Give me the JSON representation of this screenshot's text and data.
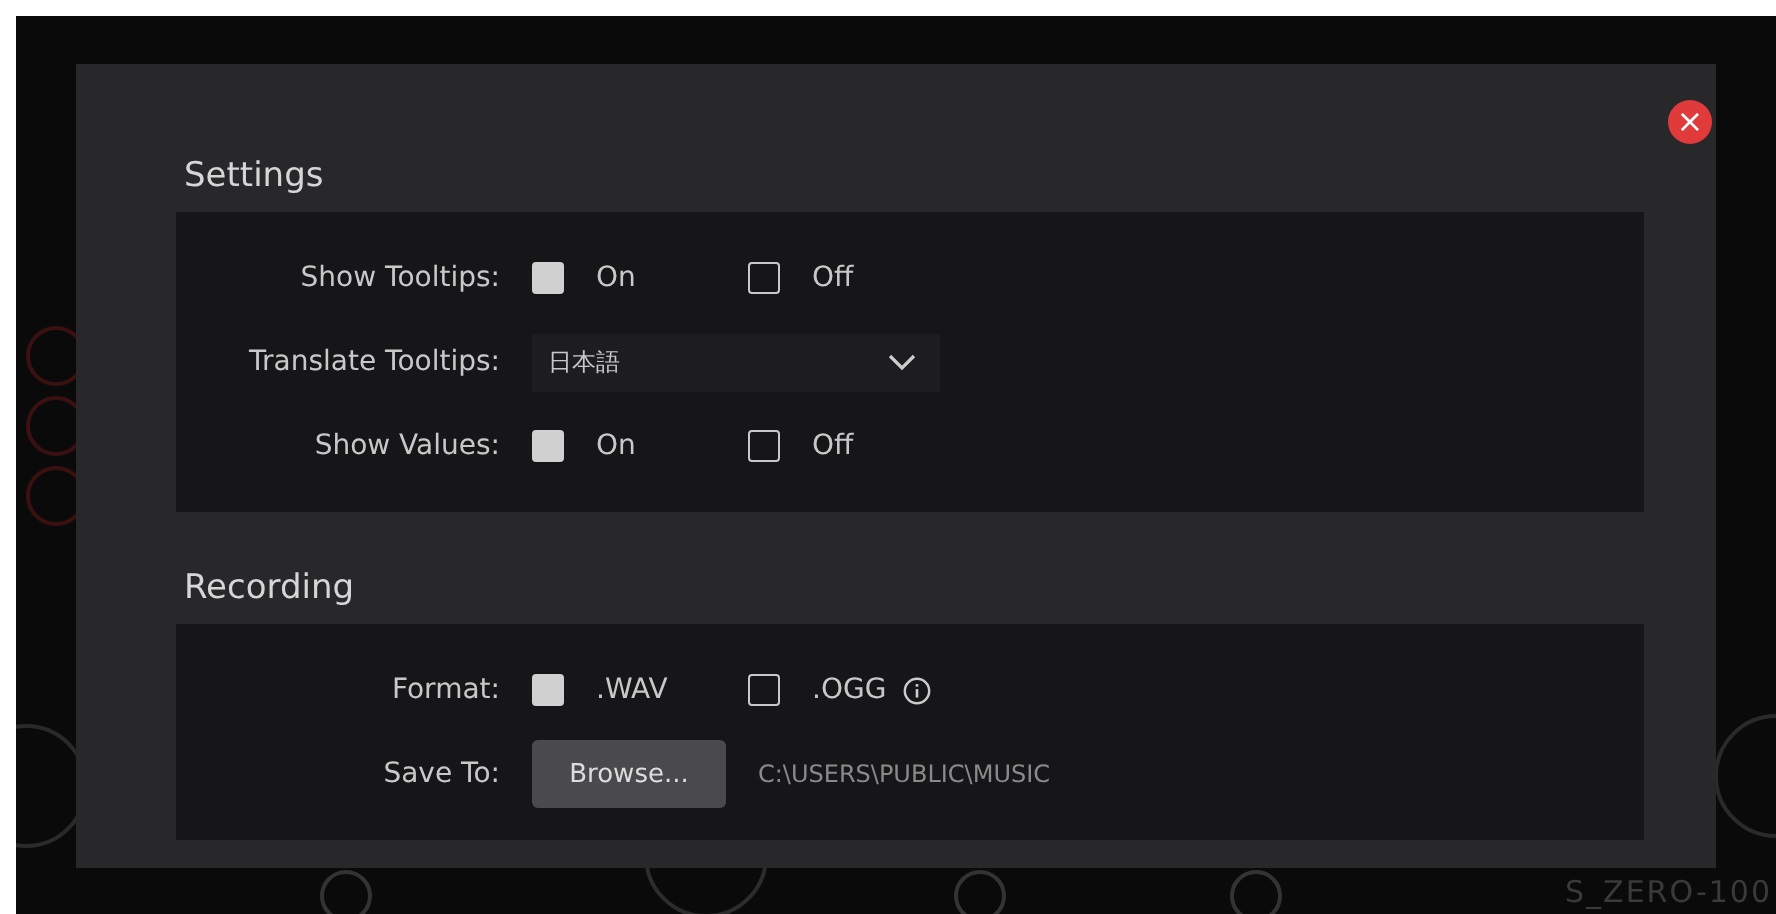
{
  "background": {
    "brand_text": "S_ZERO-100"
  },
  "dialog": {
    "close_button": "×",
    "sections": [
      {
        "title": "Settings",
        "rows": [
          {
            "kind": "options",
            "label": "Show Tooltips:",
            "options": [
              {
                "label": "On",
                "checked": true
              },
              {
                "label": "Off",
                "checked": false
              }
            ]
          },
          {
            "kind": "dropdown",
            "label": "Translate Tooltips:",
            "value": "日本語"
          },
          {
            "kind": "options",
            "label": "Show Values:",
            "options": [
              {
                "label": "On",
                "checked": true
              },
              {
                "label": "Off",
                "checked": false
              }
            ]
          }
        ]
      },
      {
        "title": "Recording",
        "rows": [
          {
            "kind": "options",
            "label": "Format:",
            "options": [
              {
                "label": ".WAV",
                "checked": true
              },
              {
                "label": ".OGG",
                "checked": false,
                "info": true
              }
            ]
          },
          {
            "kind": "path",
            "label": "Save To:",
            "button": "Browse...",
            "value": "C:\\USERS\\PUBLIC\\MUSIC"
          }
        ]
      }
    ]
  }
}
